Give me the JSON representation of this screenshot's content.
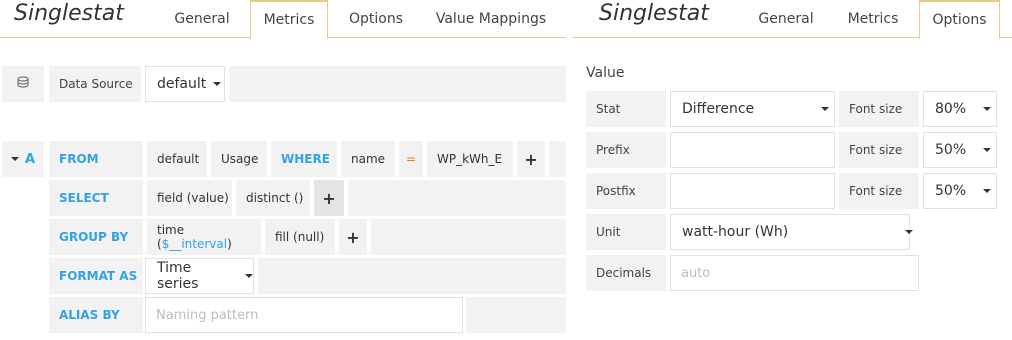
{
  "left_panel": {
    "title": "Singlestat",
    "tabs": [
      "General",
      "Metrics",
      "Options",
      "Value Mappings"
    ],
    "active_tab": "Metrics",
    "datasource": {
      "label": "Data Source",
      "value": "default"
    },
    "query": {
      "ref_id": "A",
      "from": {
        "keyword": "FROM",
        "policy": "default",
        "measurement": "Usage",
        "where_keyword": "WHERE",
        "where_key": "name",
        "where_op": "=",
        "where_value": "WP_kWh_E"
      },
      "select": {
        "keyword": "SELECT",
        "field": "field (value)",
        "func": "distinct ()"
      },
      "group_by": {
        "keyword": "GROUP BY",
        "time_prefix": "time (",
        "time_var": "$__interval",
        "time_suffix": ")",
        "fill": "fill (null)"
      },
      "format_as": {
        "keyword": "FORMAT AS",
        "value": "Time series"
      },
      "alias_by": {
        "keyword": "ALIAS BY",
        "placeholder": "Naming pattern"
      }
    }
  },
  "right_panel": {
    "title": "Singlestat",
    "tabs": [
      "General",
      "Metrics",
      "Options"
    ],
    "active_tab": "Options",
    "section_title": "Value",
    "stat": {
      "label": "Stat",
      "value": "Difference"
    },
    "font_size_label": "Font size",
    "stat_font_size": "80%",
    "prefix": {
      "label": "Prefix",
      "value": ""
    },
    "prefix_font_size": "50%",
    "postfix": {
      "label": "Postfix",
      "value": ""
    },
    "postfix_font_size": "50%",
    "unit": {
      "label": "Unit",
      "value": "watt-hour (Wh)"
    },
    "decimals": {
      "label": "Decimals",
      "placeholder": "auto"
    }
  },
  "colors": {
    "keyword": "#33a2e5",
    "operator": "#eb7b18",
    "tab_border": "#e8c98a",
    "cell_bg": "#f2f2f2"
  }
}
